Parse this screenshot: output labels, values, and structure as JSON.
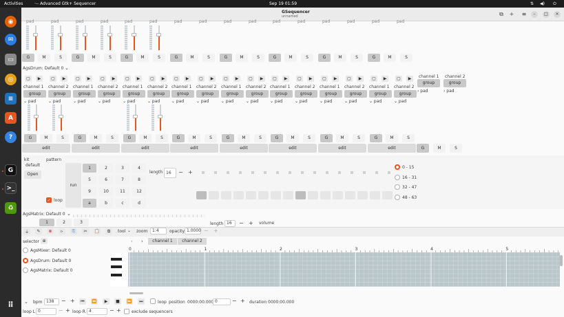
{
  "topbar": {
    "activities": "Activities",
    "app_name": "Advanced Gtk+ Sequencer",
    "clock": "Sep 19  01:59"
  },
  "window": {
    "title": "GSequencer",
    "subtitle": "unnamed"
  },
  "colors": {
    "accent": "#e95420",
    "topbar": "#1d1d1d",
    "dock": "#2b2b2b"
  },
  "dock": {
    "icons": [
      "firefox-icon",
      "thunderbird-icon",
      "files-icon",
      "rhythmbox-icon",
      "writer-icon",
      "app-center-icon",
      "help-icon",
      "gsequencer-icon",
      "terminal-icon",
      "trash-icon",
      "app-grid-icon"
    ]
  },
  "strip": {
    "pad_label": "pad",
    "mute": "G",
    "m": "M",
    "s": "S",
    "edit": "edit",
    "channel1": "channel 1",
    "channel2": "channel 2",
    "group": "group"
  },
  "drum": {
    "machine_title": "AgsDrum: Default 0",
    "kit_label": "kit",
    "kit_default": "default",
    "open_button": "Open",
    "pattern_label": "pattern",
    "run_button": "run",
    "loop_label": "loop",
    "length_label": "length",
    "length_value": "16",
    "minus": "−",
    "plus": "+",
    "index_buttons": [
      "1",
      "2",
      "3",
      "4",
      "5",
      "6",
      "7",
      "8",
      "9",
      "10",
      "11",
      "12",
      "a",
      "b",
      "c",
      "d"
    ],
    "offset_options": [
      "0 - 15",
      "16 - 31",
      "32 - 47",
      "48 - 63"
    ],
    "selected_offset": "0 - 15"
  },
  "matrix": {
    "machine_title": "AgsMatrix: Default 0",
    "index_buttons": [
      "1",
      "2",
      "3"
    ],
    "length_label": "length",
    "length_value": "16",
    "volume_label": "volume"
  },
  "editor": {
    "tool_label": "tool",
    "zoom_label": "zoom",
    "zoom_value": "1:4",
    "opacity_label": "opacity",
    "opacity_value": "1.0000",
    "selector_label": "selector",
    "machines": [
      "AgsMixer: Default 0",
      "AgsDrum: Default 0",
      "AgsMatrix: Default 0"
    ],
    "selected_machine": "AgsDrum: Default 0",
    "tabs": [
      "channel 1",
      "channel 2"
    ],
    "ruler_marks": [
      "0",
      "1",
      "2",
      "3",
      "4",
      "5"
    ]
  },
  "transport": {
    "bpm_label": "bpm",
    "bpm_value": "138",
    "loop_label": "loop",
    "position_label": "position",
    "position_value": "0000:00.000",
    "position_spin": "0",
    "duration_label": "duration",
    "duration_value": "0000:00.000",
    "loop_l_label": "loop L",
    "loop_l_value": "0",
    "loop_r_label": "loop R",
    "loop_r_value": "4",
    "exclude_label": "exclude sequencers"
  }
}
